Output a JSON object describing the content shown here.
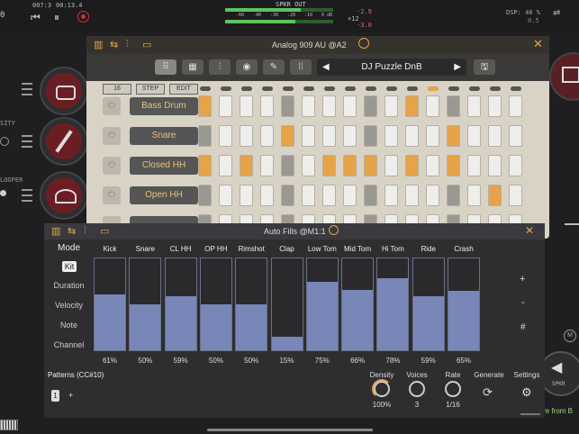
{
  "transport": {
    "position": "007:3",
    "time": "00:13.4",
    "bar_left_value": "0",
    "spkr_out_label": "SPKR OUT",
    "meter_scale": [
      "-60",
      "-40",
      "-30",
      "-20",
      "-10",
      "0 dB"
    ],
    "meter_vals": [
      "-2.9",
      "+12",
      "-3.0"
    ],
    "dsp": "DSP: 40 %",
    "mixer_value": "0.5"
  },
  "host": {
    "tracks": [
      {
        "icon": "drum-icon"
      },
      {
        "icon": "guitar-icon"
      },
      {
        "icon": "looper-wings-icon"
      }
    ],
    "looper_label": "LOOPER",
    "sensitivity_label": "SITY",
    "spkr_label": "SPKR",
    "live_from": "ive from B"
  },
  "seq": {
    "title": "Analog 909 AU @A2",
    "preset": "DJ Puzzle DnB",
    "steps_count": "16",
    "step_btn": "STEP",
    "edit_btn": "EDIT",
    "leds": [
      0,
      0,
      0,
      0,
      0,
      0,
      0,
      0,
      0,
      0,
      0,
      1,
      0,
      0,
      0,
      0
    ],
    "rows": [
      {
        "label": "Bass Drum",
        "steps": [
          1,
          0,
          0,
          0,
          2,
          0,
          0,
          0,
          2,
          0,
          1,
          0,
          2,
          0,
          0,
          0
        ]
      },
      {
        "label": "Snare",
        "steps": [
          2,
          0,
          0,
          0,
          1,
          0,
          0,
          0,
          2,
          0,
          0,
          0,
          1,
          0,
          0,
          0
        ]
      },
      {
        "label": "Closed HH",
        "steps": [
          1,
          0,
          1,
          0,
          2,
          0,
          1,
          1,
          1,
          0,
          1,
          0,
          1,
          0,
          0,
          0
        ]
      },
      {
        "label": "Open HH",
        "steps": [
          2,
          0,
          0,
          0,
          2,
          0,
          0,
          0,
          2,
          0,
          0,
          0,
          2,
          0,
          1,
          0
        ]
      }
    ]
  },
  "autofills": {
    "title": "Auto Fills @M1:1",
    "mode_label": "Mode",
    "modes": [
      "Kit",
      "Duration",
      "Velocity",
      "Note",
      "Channel"
    ],
    "selected_mode": "Kit",
    "columns": [
      {
        "name": "Kick",
        "value": 61,
        "label": "61%"
      },
      {
        "name": "Snare",
        "value": 50,
        "label": "50%"
      },
      {
        "name": "CL HH",
        "value": 59,
        "label": "59%"
      },
      {
        "name": "OP HH",
        "value": 50,
        "label": "50%"
      },
      {
        "name": "Rimshot",
        "value": 50,
        "label": "50%"
      },
      {
        "name": "Clap",
        "value": 15,
        "label": "15%"
      },
      {
        "name": "Low Tom",
        "value": 75,
        "label": "75%"
      },
      {
        "name": "Mid Tom",
        "value": 66,
        "label": "66%"
      },
      {
        "name": "Hi Tom",
        "value": 78,
        "label": "78%"
      },
      {
        "name": "Ride",
        "value": 59,
        "label": "59%"
      },
      {
        "name": "Crash",
        "value": 65,
        "label": "65%"
      }
    ],
    "side_buttons": [
      "+",
      "-",
      "#"
    ],
    "patterns_label": "Patterns (CC#10)",
    "pattern_value": "1",
    "add_pattern": "+",
    "density_label": "Density",
    "density_value": "100%",
    "voices_label": "Voices",
    "voices_value": "3",
    "rate_label": "Rate",
    "rate_value": "1/16",
    "generate_label": "Generate",
    "settings_label": "Settings"
  },
  "colors": {
    "accent": "#e6a348",
    "bar": "#7886b8"
  }
}
